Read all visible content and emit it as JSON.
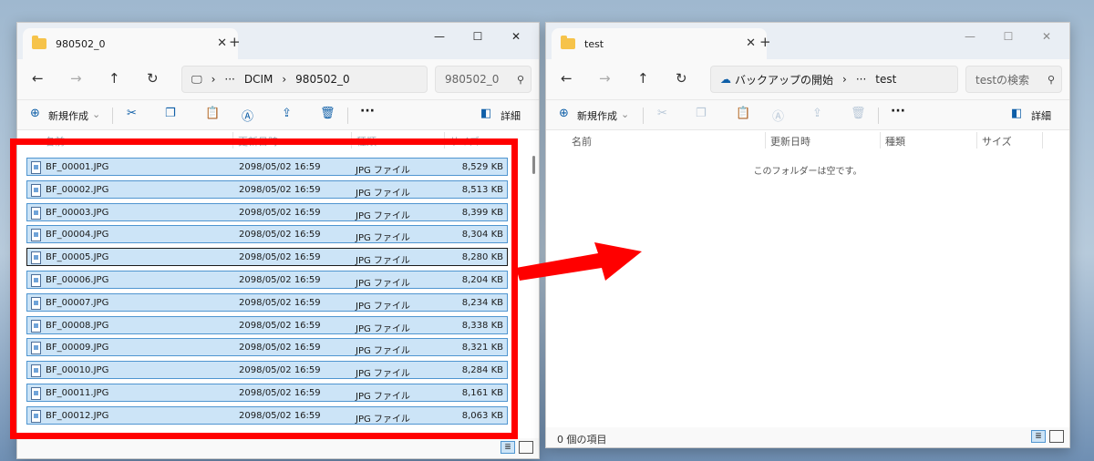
{
  "colors": {
    "accent": "#0f5fa8",
    "selection": "#cce4f7",
    "highlight": "#ff0000",
    "arrow": "#ff0000"
  },
  "left_window": {
    "tab_title": "980502_0",
    "address": {
      "icon": "computer-icon",
      "segments": [
        "DCIM",
        "980502_0"
      ],
      "more": "···"
    },
    "search_text": "980502_0",
    "toolbar": {
      "new_label": "新規作成",
      "details_label": "詳細"
    },
    "columns": [
      "名前",
      "更新日時",
      "種類",
      "サイズ"
    ],
    "files": [
      {
        "name": "BF_00001.JPG",
        "date": "2098/05/02 16:59",
        "type": "JPG ファイル",
        "size": "8,529 KB"
      },
      {
        "name": "BF_00002.JPG",
        "date": "2098/05/02 16:59",
        "type": "JPG ファイル",
        "size": "8,513 KB"
      },
      {
        "name": "BF_00003.JPG",
        "date": "2098/05/02 16:59",
        "type": "JPG ファイル",
        "size": "8,399 KB"
      },
      {
        "name": "BF_00004.JPG",
        "date": "2098/05/02 16:59",
        "type": "JPG ファイル",
        "size": "8,304 KB"
      },
      {
        "name": "BF_00005.JPG",
        "date": "2098/05/02 16:59",
        "type": "JPG ファイル",
        "size": "8,280 KB"
      },
      {
        "name": "BF_00006.JPG",
        "date": "2098/05/02 16:59",
        "type": "JPG ファイル",
        "size": "8,204 KB"
      },
      {
        "name": "BF_00007.JPG",
        "date": "2098/05/02 16:59",
        "type": "JPG ファイル",
        "size": "8,234 KB"
      },
      {
        "name": "BF_00008.JPG",
        "date": "2098/05/02 16:59",
        "type": "JPG ファイル",
        "size": "8,338 KB"
      },
      {
        "name": "BF_00009.JPG",
        "date": "2098/05/02 16:59",
        "type": "JPG ファイル",
        "size": "8,321 KB"
      },
      {
        "name": "BF_00010.JPG",
        "date": "2098/05/02 16:59",
        "type": "JPG ファイル",
        "size": "8,284 KB"
      },
      {
        "name": "BF_00011.JPG",
        "date": "2098/05/02 16:59",
        "type": "JPG ファイル",
        "size": "8,161 KB"
      },
      {
        "name": "BF_00012.JPG",
        "date": "2098/05/02 16:59",
        "type": "JPG ファイル",
        "size": "8,063 KB"
      }
    ],
    "focused_index": 4
  },
  "right_window": {
    "tab_title": "test",
    "address": {
      "icon": "cloud-backup-icon",
      "segments": [
        "バックアップの開始",
        "test"
      ],
      "more": "···"
    },
    "search_text": "testの検索",
    "toolbar": {
      "new_label": "新規作成",
      "details_label": "詳細"
    },
    "columns": [
      "名前",
      "更新日時",
      "種類",
      "サイズ"
    ],
    "empty_text": "このフォルダーは空です。",
    "status_text": "0 個の項目"
  }
}
